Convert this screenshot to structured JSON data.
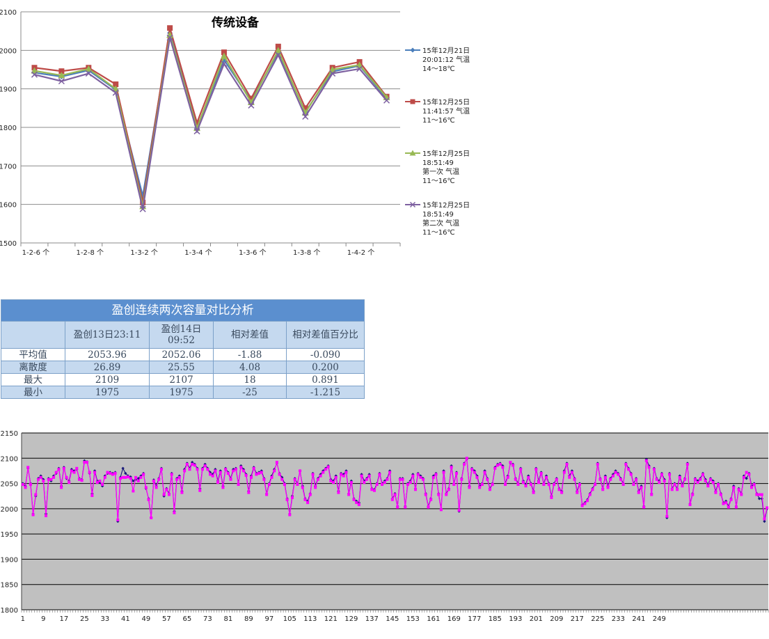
{
  "chart_data": [
    {
      "type": "line",
      "title": "传统设备",
      "categories": [
        "1-2-6 个",
        "",
        "1-2-8 个",
        "",
        "1-3-2 个",
        "",
        "1-3-4 个",
        "",
        "1-3-6 个",
        "",
        "1-3-8 个",
        "",
        "1-4-2 个",
        ""
      ],
      "ylim": [
        1500,
        2100
      ],
      "yticks": [
        1500,
        1600,
        1700,
        1800,
        1900,
        2000,
        2100
      ],
      "grid": true,
      "legend_position": "right",
      "series": [
        {
          "name": "15年12月21日 20:01:12 气温 14～18℃",
          "legend_lines": [
            "15年12月21日",
            "20:01:12 气温",
            "14～18℃"
          ],
          "color": "#4a7ebb",
          "marker": "diamond",
          "values": [
            1942,
            1932,
            1948,
            1898,
            1622,
            2045,
            1800,
            1975,
            1870,
            1995,
            1840,
            1945,
            1960,
            1875
          ]
        },
        {
          "name": "15年12月25日 11:41:57 气温 11～16℃",
          "legend_lines": [
            "15年12月25日",
            "11:41:57 气温",
            "11～16℃"
          ],
          "color": "#be4b48",
          "marker": "square",
          "values": [
            1955,
            1946,
            1955,
            1912,
            1605,
            2058,
            1812,
            1995,
            1875,
            2010,
            1850,
            1955,
            1970,
            1880
          ]
        },
        {
          "name": "15年12月25日 18:51:49 第一次 气温 11～16℃",
          "legend_lines": [
            "15年12月25日",
            "18:51:49",
            "第一次 气温",
            "11～16℃"
          ],
          "color": "#98b954",
          "marker": "triangle",
          "values": [
            1947,
            1935,
            1952,
            1900,
            1595,
            2040,
            1798,
            1985,
            1865,
            2000,
            1838,
            1950,
            1962,
            1878
          ]
        },
        {
          "name": "15年12月25日 18:51:49 第二次 气温 11～16℃",
          "legend_lines": [
            "15年12月25日",
            "18:51:49",
            "第二次 气温",
            "11～16℃"
          ],
          "color": "#7d60a0",
          "marker": "x",
          "values": [
            1937,
            1920,
            1940,
            1890,
            1588,
            2033,
            1790,
            1965,
            1857,
            1988,
            1828,
            1940,
            1952,
            1870
          ]
        }
      ]
    },
    {
      "type": "line",
      "title": "",
      "ylim": [
        1800,
        2150
      ],
      "yticks": [
        1800,
        1850,
        1900,
        1950,
        2000,
        2050,
        2100,
        2150
      ],
      "xtick_labels": [
        "1",
        "9",
        "17",
        "25",
        "33",
        "41",
        "49",
        "57",
        "65",
        "73",
        "81",
        "89",
        "97",
        "105",
        "113",
        "121",
        "129",
        "137",
        "145",
        "153",
        "161",
        "169",
        "177",
        "185",
        "193",
        "201",
        "209",
        "217",
        "225",
        "233",
        "241",
        "249"
      ],
      "grid": true,
      "plot_background": "#c0c0c0",
      "series": [
        {
          "color": "#1a1a7a",
          "marker": "diamond",
          "values": [
            2050,
            2045,
            2080,
            2050,
            1990,
            2025,
            2060,
            2065,
            2058,
            1990,
            2060,
            2055,
            2065,
            2070,
            2080,
            2045,
            2082,
            2060,
            2055,
            2078,
            2075,
            2078,
            2060,
            2058,
            2095,
            2093,
            2070,
            2030,
            2075,
            2055,
            2052,
            2045,
            2065,
            2070,
            2072,
            2070,
            2072,
            1975,
            2062,
            2080,
            2070,
            2065,
            2063,
            2055,
            2058,
            2060,
            2065,
            2070,
            2040,
            2020,
            1983,
            2057,
            2045,
            2060,
            2080,
            2025,
            2040,
            2030,
            2070,
            1995,
            2060,
            2065,
            2035,
            2078,
            2090,
            2080,
            2092,
            2088,
            2080,
            2040,
            2080,
            2088,
            2080,
            2072,
            2068,
            2078,
            2055,
            2075,
            2045,
            2080,
            2072,
            2060,
            2078,
            2080,
            2050,
            2085,
            2078,
            2068,
            2035,
            2065,
            2082,
            2070,
            2072,
            2075,
            2060,
            2030,
            2050,
            2065,
            2078,
            2090,
            2070,
            2062,
            2050,
            2020,
            1990,
            2025,
            2060,
            2050,
            2075,
            2045,
            2020,
            2015,
            2030,
            2070,
            2045,
            2060,
            2068,
            2075,
            2080,
            2085,
            2058,
            2055,
            2065,
            2035,
            2070,
            2068,
            2075,
            2030,
            2055,
            2020,
            2015,
            2012,
            2068,
            2055,
            2060,
            2068,
            2040,
            2038,
            2050,
            2070,
            2050,
            2055,
            2060,
            2075,
            2020,
            2030,
            2005,
            2060,
            2060,
            2005,
            2050,
            2055,
            2068,
            2040,
            2070,
            2065,
            2060,
            2030,
            2005,
            2020,
            2065,
            2070,
            2030,
            2000,
            2075,
            2030,
            2040,
            2085,
            2050,
            2072,
            1995,
            2060,
            2090,
            2098,
            2045,
            2080,
            2075,
            2065,
            2045,
            2050,
            2075,
            2060,
            2040,
            2050,
            2082,
            2088,
            2090,
            2085,
            2050,
            2065,
            2090,
            2088,
            2060,
            2050,
            2080,
            2055,
            2048,
            2065,
            2050,
            2035,
            2080,
            2055,
            2072,
            2050,
            2065,
            2050,
            2025,
            2050,
            2060,
            2040,
            2035,
            2075,
            2090,
            2065,
            2075,
            2060,
            2035,
            2050,
            2008,
            2012,
            2018,
            2030,
            2040,
            2050,
            2090,
            2060,
            2040,
            2065,
            2045,
            2060,
            2068,
            2075,
            2070,
            2060,
            2050,
            2090,
            2080,
            2070,
            2050,
            2060,
            2035,
            2045,
            2005,
            2098,
            2085,
            2030,
            2080,
            2060,
            2055,
            2070,
            2058,
            1982,
            2070,
            2040,
            2050,
            2040,
            2065,
            2048,
            2060,
            2090,
            2010,
            2030,
            2060,
            2055,
            2060,
            2070,
            2058,
            2048,
            2060,
            2055,
            2035,
            2050,
            2030,
            2012,
            2015,
            2005,
            2020,
            2045,
            2005,
            2040,
            2030,
            2065,
            2060,
            2070,
            2045,
            2050,
            2030,
            2020,
            2020,
            1975,
            2000
          ]
        },
        {
          "color": "#ff00ff",
          "marker": "square",
          "values": [
            2048,
            2042,
            2082,
            2048,
            1988,
            2028,
            2058,
            2062,
            2055,
            1986,
            2058,
            2058,
            2062,
            2072,
            2078,
            2042,
            2080,
            2062,
            2052,
            2075,
            2072,
            2080,
            2058,
            2056,
            2092,
            2092,
            2072,
            2026,
            2072,
            2052,
            2055,
            2048,
            2062,
            2072,
            2070,
            2068,
            2070,
            1978,
            2060,
            2062,
            2062,
            2063,
            2060,
            2035,
            2062,
            2055,
            2062,
            2068,
            2042,
            2018,
            1982,
            2055,
            2042,
            2058,
            2078,
            2028,
            2038,
            2028,
            2068,
            1992,
            2058,
            2062,
            2032,
            2075,
            2088,
            2078,
            2088,
            2086,
            2078,
            2036,
            2078,
            2085,
            2078,
            2068,
            2065,
            2075,
            2052,
            2072,
            2042,
            2078,
            2070,
            2058,
            2075,
            2078,
            2048,
            2082,
            2075,
            2066,
            2032,
            2062,
            2080,
            2068,
            2070,
            2072,
            2058,
            2028,
            2048,
            2062,
            2075,
            2092,
            2068,
            2058,
            2048,
            2018,
            1988,
            2022,
            2058,
            2048,
            2075,
            2042,
            2018,
            2012,
            2028,
            2068,
            2042,
            2058,
            2065,
            2072,
            2078,
            2083,
            2055,
            2052,
            2062,
            2032,
            2068,
            2065,
            2072,
            2028,
            2052,
            2018,
            2012,
            2008,
            2065,
            2052,
            2058,
            2065,
            2038,
            2036,
            2048,
            2068,
            2048,
            2052,
            2058,
            2072,
            2018,
            2028,
            2003,
            2058,
            2058,
            2003,
            2048,
            2052,
            2065,
            2038,
            2068,
            2062,
            2058,
            2028,
            2003,
            2018,
            2062,
            2068,
            2028,
            1998,
            2072,
            2028,
            2038,
            2082,
            2048,
            2070,
            1997,
            2058,
            2088,
            2100,
            2042,
            2078,
            2072,
            2062,
            2042,
            2048,
            2072,
            2058,
            2038,
            2048,
            2080,
            2086,
            2088,
            2082,
            2048,
            2062,
            2092,
            2086,
            2058,
            2048,
            2078,
            2052,
            2045,
            2062,
            2048,
            2032,
            2078,
            2052,
            2070,
            2048,
            2062,
            2048,
            2022,
            2048,
            2058,
            2038,
            2032,
            2072,
            2088,
            2062,
            2072,
            2058,
            2032,
            2048,
            2006,
            2010,
            2016,
            2028,
            2038,
            2048,
            2088,
            2058,
            2038,
            2062,
            2042,
            2058,
            2065,
            2072,
            2068,
            2058,
            2048,
            2088,
            2078,
            2068,
            2048,
            2058,
            2032,
            2042,
            2003,
            2095,
            2082,
            2028,
            2078,
            2058,
            2052,
            2068,
            2055,
            1985,
            2068,
            2038,
            2048,
            2038,
            2062,
            2045,
            2058,
            2088,
            2008,
            2028,
            2058,
            2052,
            2058,
            2068,
            2055,
            2045,
            2058,
            2052,
            2032,
            2048,
            2028,
            2010,
            2012,
            2003,
            2018,
            2042,
            2003,
            2038,
            2028,
            2062,
            2072,
            2068,
            2042,
            2048,
            2028,
            2028,
            2028,
            1980,
            2002
          ]
        }
      ]
    }
  ],
  "stats_table": {
    "title": "盈创连续两次容量对比分析",
    "headers": [
      "",
      "盈创13日23:11",
      "盈创14日 09:52",
      "相对差值",
      "相对差值百分比"
    ],
    "rows": [
      {
        "label": "平均值",
        "a": "2053.96",
        "b": "2052.06",
        "diff": "-1.88",
        "pct": "-0.090"
      },
      {
        "label": "离散度",
        "a": "26.89",
        "b": "25.55",
        "diff": "4.08",
        "pct": "0.200"
      },
      {
        "label": "最大",
        "a": "2109",
        "b": "2107",
        "diff": "18",
        "pct": "0.891"
      },
      {
        "label": "最小",
        "a": "1975",
        "b": "1975",
        "diff": "-25",
        "pct": "-1.215"
      }
    ]
  }
}
